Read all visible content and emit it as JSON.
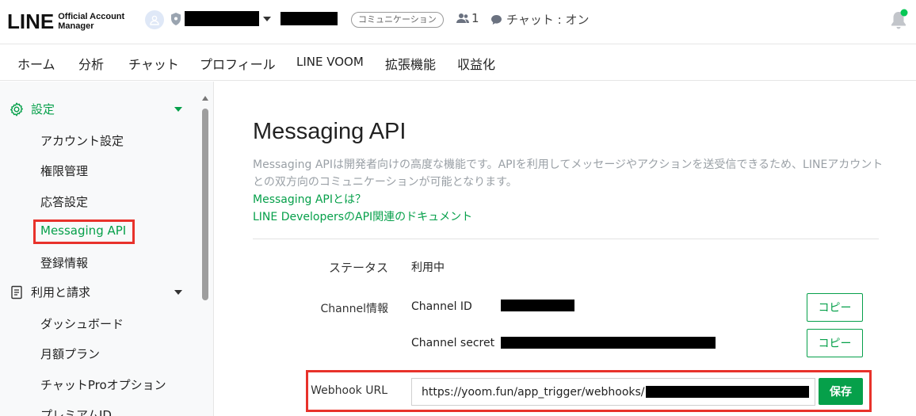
{
  "header": {
    "logo_main": "LINE",
    "logo_sub_line1": "Official Account",
    "logo_sub_line2": "Manager",
    "account_type": "コミュニケーション",
    "followers_count": "1",
    "chat_status": "チャット : オン"
  },
  "nav": {
    "items": [
      "ホーム",
      "分析",
      "チャット",
      "プロフィール",
      "LINE VOOM",
      "拡張機能",
      "収益化"
    ]
  },
  "sidebar": {
    "settings_label": "設定",
    "settings_items": [
      "アカウント設定",
      "権限管理",
      "応答設定",
      "Messaging API",
      "登録情報"
    ],
    "billing_label": "利用と請求",
    "billing_items": [
      "ダッシュボード",
      "月額プラン",
      "チャットProオプション",
      "プレミアムID"
    ]
  },
  "main": {
    "title": "Messaging API",
    "description_line1": "Messaging APIは開発者向けの高度な機能です。APIを利用してメッセージやアクションを送受信できるため、LINEアカウント",
    "description_line2": "との双方向のコミュニケーションが可能となります。",
    "link_what": "Messaging APIとは？",
    "link_docs": "LINE DevelopersのAPI関連のドキュメント",
    "status_label": "ステータス",
    "status_value": "利用中",
    "channel_label": "Channel情報",
    "channel_id_label": "Channel ID",
    "channel_secret_label": "Channel secret",
    "copy_label": "コピー",
    "webhook_label": "Webhook URL",
    "webhook_value": "https://yoom.fun/app_trigger/webhooks/",
    "save_label": "保存"
  },
  "colors": {
    "brand_green": "#06a04a",
    "highlight_red": "#e8322b",
    "notification_dot": "#06c755"
  }
}
